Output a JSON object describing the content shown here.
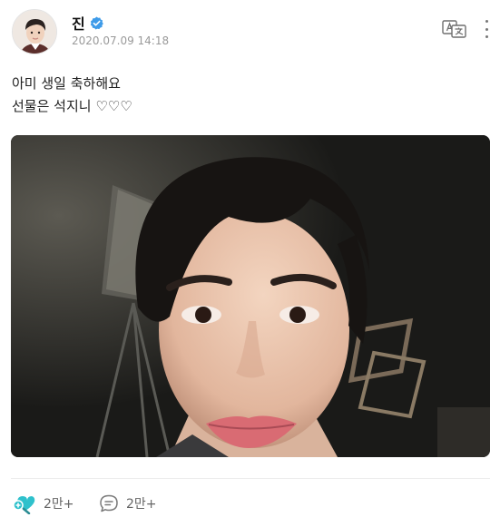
{
  "post": {
    "author_name": "진",
    "verified": true,
    "timestamp": "2020.07.09 14:18",
    "text_lines": [
      "아미 생일 축하해요",
      "선물은 석지니 ♡♡♡"
    ]
  },
  "actions": {
    "like_count": "2만+",
    "comment_count": "2만+"
  },
  "icons": {
    "verified": "verified-badge-icon",
    "translate": "translate-icon",
    "more": "more-vertical-icon",
    "like": "like-icon",
    "comment": "comment-icon"
  },
  "colors": {
    "accent": "#2fc1cc",
    "verified": "#3e9be9",
    "muted_text": "#9a9a9a"
  }
}
